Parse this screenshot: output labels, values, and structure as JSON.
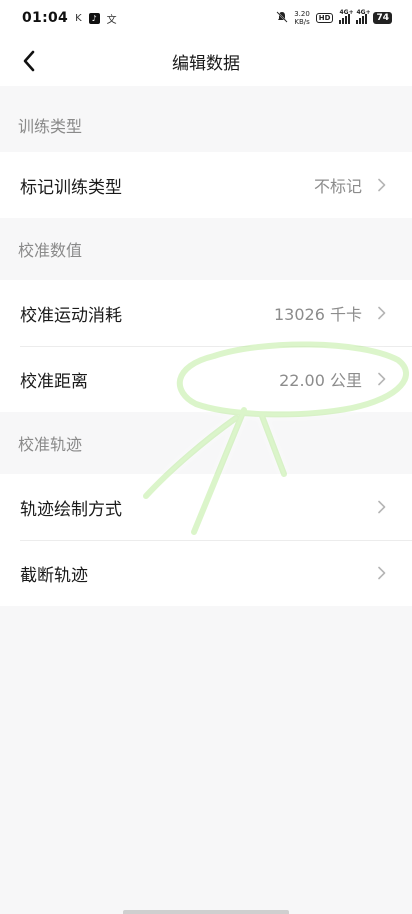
{
  "status_bar": {
    "time": "01:04",
    "notif_k": "K",
    "notif_tiktok": "♪",
    "notif_wen": "文",
    "net_speed_value": "3.20",
    "net_speed_unit": "KB/s",
    "hd_label": "HD",
    "signal1_tag": "4G+",
    "signal2_tag": "4G+",
    "battery": "74"
  },
  "nav": {
    "title": "编辑数据",
    "back_icon": "chevron-left-icon"
  },
  "sections": {
    "training_type": {
      "header": "训练类型",
      "rows": [
        {
          "label": "标记训练类型",
          "value": "不标记"
        }
      ]
    },
    "calibrate_values": {
      "header": "校准数值",
      "rows": [
        {
          "label": "校准运动消耗",
          "value": "13026 千卡"
        },
        {
          "label": "校准距离",
          "value": "22.00 公里"
        }
      ]
    },
    "calibrate_track": {
      "header": "校准轨迹",
      "rows": [
        {
          "label": "轨迹绘制方式",
          "value": ""
        },
        {
          "label": "截断轨迹",
          "value": ""
        }
      ]
    }
  },
  "colors": {
    "background": "#f7f7f8",
    "card": "#ffffff",
    "secondary_text": "#8c8c8c",
    "annotation_green": "#9be36a"
  }
}
